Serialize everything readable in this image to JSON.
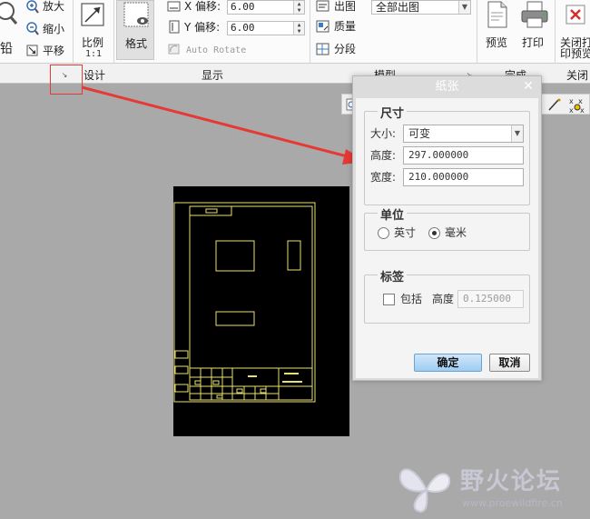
{
  "ribbon": {
    "zoom_in_label": "放大",
    "zoom_out_label": "缩小",
    "pan_label": "平移",
    "scale_label": "比例",
    "scale_value": "1:1",
    "format_label": "格式",
    "x_offset_label": "X 偏移:",
    "x_offset_value": "6.00",
    "y_offset_label": "Y 偏移:",
    "y_offset_value": "6.00",
    "auto_rotate_label": "Auto Rotate",
    "output_label": "出图",
    "quality_label": "质量",
    "segment_label": "分段",
    "output_combo_value": "全部出图",
    "preview_label": "预览",
    "print_label": "打印",
    "close_label_line1": "关闭打",
    "close_label_line2": "印预览"
  },
  "groups": {
    "design": "设计",
    "display": "显示",
    "model": "模型",
    "finish": "完成",
    "close": "关闭"
  },
  "dialog": {
    "title": "纸张",
    "size_legend": "尺寸",
    "size_label": "大小:",
    "size_value": "可变",
    "height_label": "高度:",
    "height_value": "297.000000",
    "width_label": "宽度:",
    "width_value": "210.000000",
    "units_legend": "单位",
    "inch_label": "英寸",
    "mm_label": "毫米",
    "selected_unit": "mm",
    "label_legend": "标签",
    "include_label": "包括",
    "label_height_label": "高度",
    "label_height_value": "0.125000",
    "include_checked": false,
    "ok_label": "确定",
    "cancel_label": "取消"
  },
  "watermark": {
    "title": "野火论坛",
    "url": "www.proewildfire.cn"
  },
  "colors": {
    "dialog_title_bar": "#dcdcdc",
    "ok_button": "#a9d3f5",
    "drawing_line": "#e8e070",
    "arrow": "#e53935",
    "canvas": "#a9a9a9"
  }
}
